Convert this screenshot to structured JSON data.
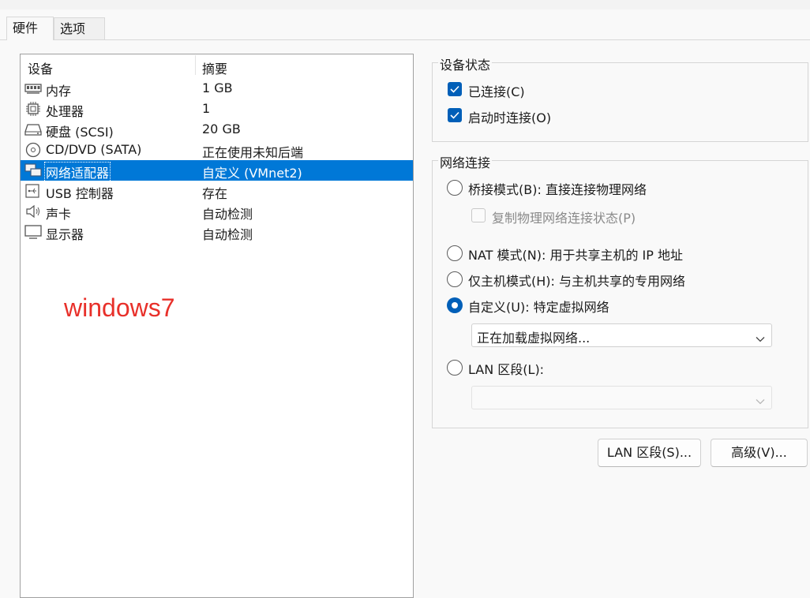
{
  "tabs": [
    {
      "label": "硬件"
    },
    {
      "label": "选项"
    }
  ],
  "device_list": {
    "header": {
      "device": "设备",
      "summary": "摘要"
    },
    "rows": [
      {
        "name": "内存",
        "summary": "1 GB",
        "icon": "memory-icon"
      },
      {
        "name": "处理器",
        "summary": "1",
        "icon": "processor-icon"
      },
      {
        "name": "硬盘 (SCSI)",
        "summary": "20 GB",
        "icon": "hard-disk-icon"
      },
      {
        "name": "CD/DVD (SATA)",
        "summary": "正在使用未知后端",
        "icon": "cd-dvd-icon"
      },
      {
        "name": "网络适配器",
        "summary": "自定义 (VMnet2)",
        "icon": "network-adapter-icon",
        "selected": true
      },
      {
        "name": "USB 控制器",
        "summary": "存在",
        "icon": "usb-icon"
      },
      {
        "name": "声卡",
        "summary": "自动检测",
        "icon": "speaker-icon"
      },
      {
        "name": "显示器",
        "summary": "自动检测",
        "icon": "display-icon"
      }
    ]
  },
  "overlay_text": "windows7",
  "device_status": {
    "title": "设备状态",
    "connected": {
      "label": "已连接(C)",
      "checked": true
    },
    "connect_at_power_on": {
      "label": "启动时连接(O)",
      "checked": true
    }
  },
  "network_connection": {
    "title": "网络连接",
    "bridged": {
      "label": "桥接模式(B): 直接连接物理网络",
      "selected": false
    },
    "replicate": {
      "label": "复制物理网络连接状态(P)",
      "checked": false,
      "enabled": false
    },
    "nat": {
      "label": "NAT 模式(N): 用于共享主机的 IP 地址",
      "selected": false
    },
    "host_only": {
      "label": "仅主机模式(H): 与主机共享的专用网络",
      "selected": false
    },
    "custom": {
      "label": "自定义(U): 特定虚拟网络",
      "selected": true
    },
    "custom_select_value": "正在加载虚拟网络...",
    "lan_segment": {
      "label": "LAN 区段(L):",
      "selected": false
    },
    "lan_select_value": ""
  },
  "buttons": {
    "lan_segments": "LAN 区段(S)...",
    "advanced": "高级(V)..."
  },
  "colors": {
    "accent": "#005fb8",
    "selection": "#0078d7",
    "overlay": "#e8302a"
  }
}
